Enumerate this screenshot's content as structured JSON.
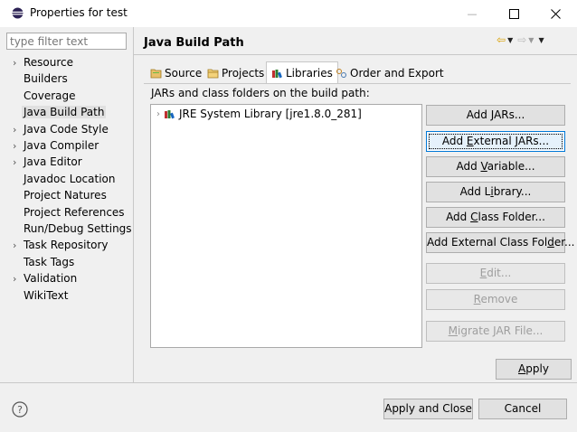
{
  "window": {
    "title": "Properties for test",
    "minimize_glyph": "—",
    "maximize_glyph": "☐",
    "close_glyph": "✕"
  },
  "filter": {
    "placeholder": "type filter text",
    "value": ""
  },
  "nav": {
    "items": [
      {
        "label": "Resource",
        "expandable": true,
        "selected": false
      },
      {
        "label": "Builders",
        "expandable": false,
        "selected": false
      },
      {
        "label": "Coverage",
        "expandable": false,
        "selected": false
      },
      {
        "label": "Java Build Path",
        "expandable": false,
        "selected": true
      },
      {
        "label": "Java Code Style",
        "expandable": true,
        "selected": false
      },
      {
        "label": "Java Compiler",
        "expandable": true,
        "selected": false
      },
      {
        "label": "Java Editor",
        "expandable": true,
        "selected": false
      },
      {
        "label": "Javadoc Location",
        "expandable": false,
        "selected": false
      },
      {
        "label": "Project Natures",
        "expandable": false,
        "selected": false
      },
      {
        "label": "Project References",
        "expandable": false,
        "selected": false
      },
      {
        "label": "Run/Debug Settings",
        "expandable": false,
        "selected": false
      },
      {
        "label": "Task Repository",
        "expandable": true,
        "selected": false
      },
      {
        "label": "Task Tags",
        "expandable": false,
        "selected": false
      },
      {
        "label": "Validation",
        "expandable": true,
        "selected": false
      },
      {
        "label": "WikiText",
        "expandable": false,
        "selected": false
      }
    ]
  },
  "page": {
    "title": "Java Build Path",
    "tabs": [
      {
        "label": "Source",
        "icon": "source-folder-icon",
        "active": false
      },
      {
        "label": "Projects",
        "icon": "projects-icon",
        "active": false
      },
      {
        "label": "Libraries",
        "icon": "libraries-icon",
        "active": true
      },
      {
        "label": "Order and Export",
        "icon": "order-export-icon",
        "active": false
      }
    ],
    "libraries_label": "JARs and class folders on the build path:",
    "tree": [
      {
        "label": "JRE System Library [jre1.8.0_281]",
        "icon": "library-icon",
        "expanded": false
      }
    ],
    "buttons": [
      {
        "pre": "Add ",
        "u": "J",
        "post": "ARs...",
        "enabled": true,
        "focused": false
      },
      {
        "pre": "Add ",
        "u": "E",
        "post": "xternal JARs...",
        "enabled": true,
        "focused": true
      },
      {
        "pre": "Add ",
        "u": "V",
        "post": "ariable...",
        "enabled": true,
        "focused": false
      },
      {
        "pre": "Add L",
        "u": "i",
        "post": "brary...",
        "enabled": true,
        "focused": false
      },
      {
        "pre": "Add ",
        "u": "C",
        "post": "lass Folder...",
        "enabled": true,
        "focused": false
      },
      {
        "pre": "Add External Class Fol",
        "u": "d",
        "post": "er...",
        "enabled": true,
        "focused": false
      },
      {
        "pre": "",
        "u": "E",
        "post": "dit...",
        "enabled": false,
        "focused": false
      },
      {
        "pre": "",
        "u": "R",
        "post": "emove",
        "enabled": false,
        "focused": false
      },
      {
        "pre": "",
        "u": "M",
        "post": "igrate JAR File...",
        "enabled": false,
        "focused": false
      }
    ]
  },
  "footer": {
    "apply": {
      "pre": "",
      "u": "A",
      "post": "pply"
    },
    "apply_close": "Apply and Close",
    "cancel": "Cancel"
  },
  "colors": {
    "accent_focus": "#0078d7",
    "nav_arrow": "#d9a000",
    "disabled_text": "#9e9e9e"
  }
}
